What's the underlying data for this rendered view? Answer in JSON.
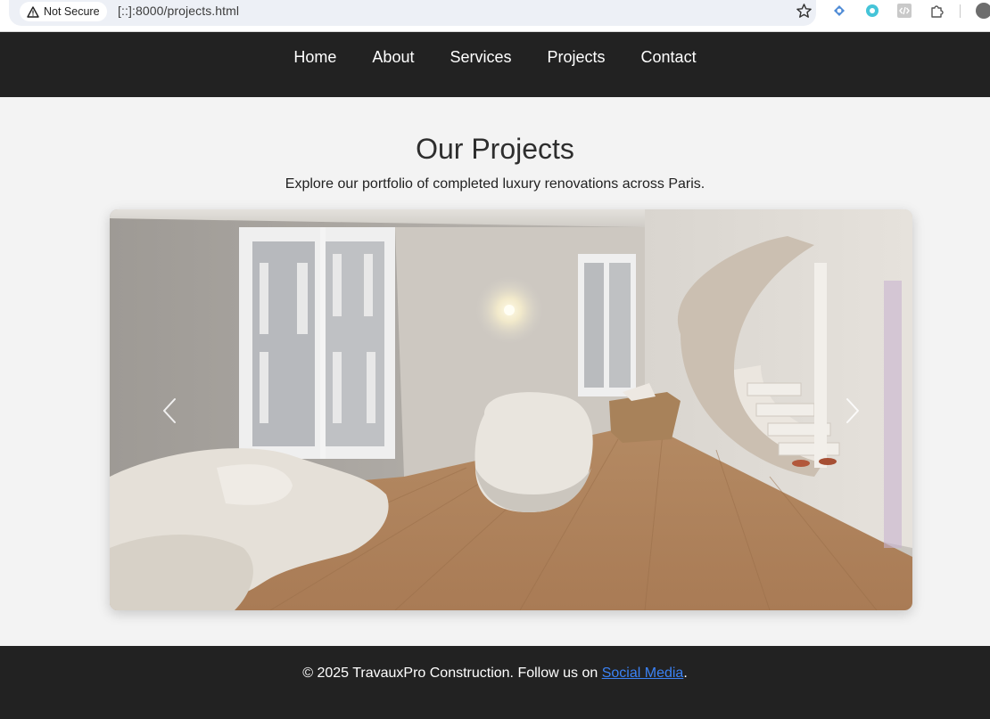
{
  "browser": {
    "security_label": "Not Secure",
    "url": "[::]:8000/projects.html",
    "icons": [
      "warning-icon",
      "star-icon",
      "extension-icon",
      "extension-icon",
      "code-icon",
      "puzzle-icon",
      "avatar"
    ]
  },
  "nav": {
    "items": [
      {
        "label": "Home"
      },
      {
        "label": "About"
      },
      {
        "label": "Services"
      },
      {
        "label": "Projects"
      },
      {
        "label": "Contact"
      }
    ]
  },
  "main": {
    "title": "Our Projects",
    "intro": "Explore our portfolio of completed luxury renovations across Paris.",
    "carousel": {
      "prev_icon": "chevron-left-icon",
      "next_icon": "chevron-right-icon"
    }
  },
  "footer": {
    "text_before": "© 2025 TravauxPro Construction. Follow us on ",
    "link_label": "Social Media",
    "text_after": "."
  },
  "colors": {
    "nav_bg": "#222222",
    "page_bg": "#f3f3f3",
    "footer_bg": "#222222",
    "link": "#3b82f6"
  }
}
